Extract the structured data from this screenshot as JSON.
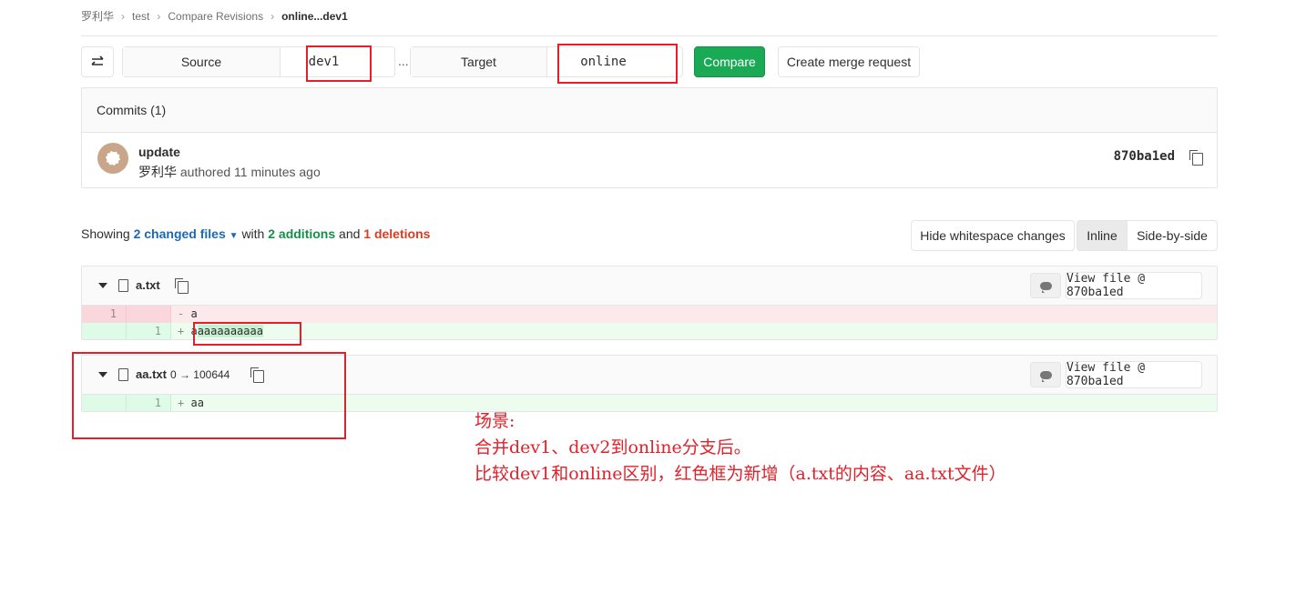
{
  "breadcrumb": {
    "owner": "罗利华",
    "project": "test",
    "section": "Compare Revisions",
    "current": "online...dev1"
  },
  "compare": {
    "source_label": "Source",
    "source_value": "dev1",
    "separator": "...",
    "target_label": "Target",
    "target_value": "online",
    "compare_button": "Compare",
    "merge_button": "Create merge request"
  },
  "commits": {
    "header": "Commits (1)",
    "items": [
      {
        "title": "update",
        "author": "罗利华",
        "meta": "authored 11 minutes ago",
        "sha": "870ba1ed"
      }
    ]
  },
  "summary": {
    "showing": "Showing",
    "changed_files": "2 changed files",
    "with": "with",
    "additions": "2 additions",
    "and": "and",
    "deletions": "1 deletions"
  },
  "view_options": {
    "whitespace": "Hide whitespace changes",
    "inline": "Inline",
    "side_by_side": "Side-by-side"
  },
  "files": [
    {
      "name": "a.txt",
      "mode": "",
      "view_label": "View file @ 870ba1ed",
      "lines": [
        {
          "type": "old",
          "old_no": "1",
          "new_no": "",
          "marker": "-",
          "text": "a"
        },
        {
          "type": "new",
          "old_no": "",
          "new_no": "1",
          "marker": "+",
          "text_plain": "a",
          "text_highlight": "aaaaaaaaaa"
        }
      ]
    },
    {
      "name": "aa.txt",
      "mode": "0 → 100644",
      "view_label": "View file @ 870ba1ed",
      "lines": [
        {
          "type": "new",
          "old_no": "",
          "new_no": "1",
          "marker": "+",
          "text": "aa"
        }
      ]
    }
  ],
  "annotation": {
    "line1": "场景:",
    "line2": "合并dev1、dev2到online分支后。",
    "line3": "比较dev1和online区别，红色框为新增（a.txt的内容、aa.txt文件）"
  },
  "colors": {
    "accent_green": "#1aaa55",
    "annotation_red": "#e0202a",
    "link_blue": "#1b69b6",
    "addition_green": "#168f48",
    "deletion_red": "#db3b21"
  }
}
